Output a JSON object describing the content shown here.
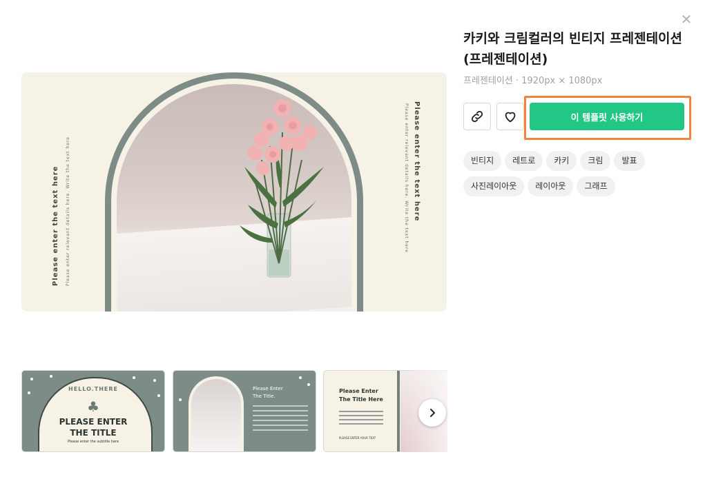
{
  "dialog": {
    "title": "카키와 크림컬러의 빈티지 프레젠테이션 (프레젠테이션)",
    "meta": "프레젠테이션 · 1920px × 1080px",
    "use_button_label": "이 템플릿 사용하기",
    "close_icon": "close-icon",
    "link_icon": "link-icon",
    "heart_icon": "heart-icon"
  },
  "tags": [
    "빈티지",
    "레트로",
    "카키",
    "크림",
    "발표",
    "사진레이아웃",
    "레이아웃",
    "그래프"
  ],
  "preview": {
    "left_title": "Please enter the text here",
    "left_sub": "Please enter relevant details here. Write the text here",
    "right_title": "Please enter the text here",
    "right_sub": "Please enter relevant details here. Write the text here"
  },
  "thumbnails": {
    "t1_hello": "HELLO.THERE",
    "t1_title_line1": "PLEASE ENTER",
    "t1_title_line2": "THE TITLE",
    "t1_sub": "Please enter the subtitle here",
    "t2_title_line1": "Please Enter",
    "t2_title_line2": "The Title.",
    "t3_title_line1": "Please Enter",
    "t3_title_line2": "The Title Here",
    "t3_foot": "PLEASE ENTER YOUR TEXT"
  },
  "colors": {
    "accent": "#22c785",
    "highlight": "#f4823a",
    "khaki": "#7d8c86",
    "cream": "#f6f2e6"
  }
}
